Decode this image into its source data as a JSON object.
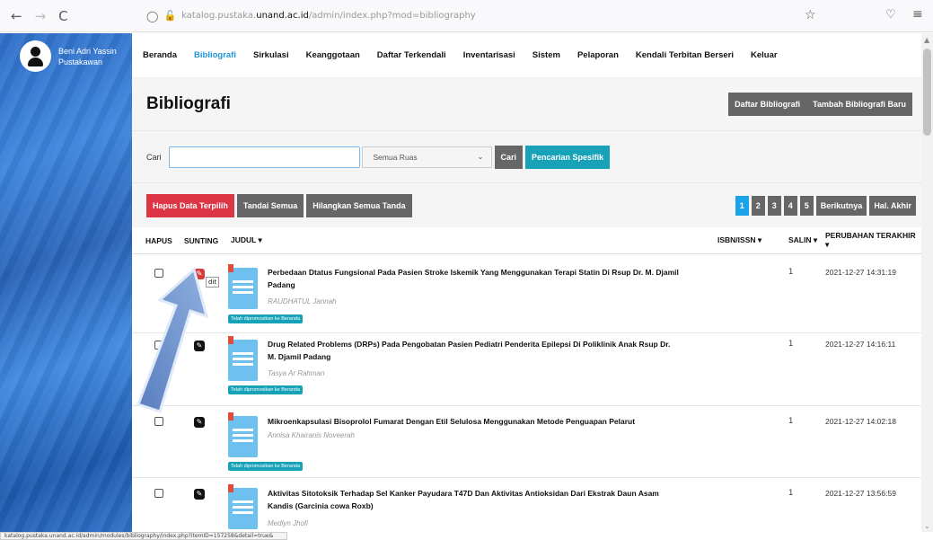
{
  "browser": {
    "back": "←",
    "forward": "→",
    "reload": "C",
    "url_prefix": "katalog.pustaka.",
    "url_host": "unand.ac.id",
    "url_path": "/admin/index.php?mod=bibliography",
    "status_url": "katalog.pustaka.unand.ac.id/admin/modules/bibliography/index.php?itemID=157258&detail=true&"
  },
  "sidebar": {
    "user_name": "Beni Adri Yassin",
    "user_role": "Pustakawan"
  },
  "nav": [
    "Beranda",
    "Bibliografi",
    "Sirkulasi",
    "Keanggotaan",
    "Daftar Terkendali",
    "Inventarisasi",
    "Sistem",
    "Pelaporan",
    "Kendali Terbitan Berseri",
    "Keluar"
  ],
  "page": {
    "title": "Bibliografi",
    "btn_list": "Daftar Bibliografi",
    "btn_add": "Tambah Bibliografi Baru"
  },
  "search": {
    "label": "Cari",
    "value": "",
    "field_select": "Semua Ruas",
    "btn_search": "Cari",
    "btn_advanced": "Pencarian Spesifik"
  },
  "actions": {
    "delete_selected": "Hapus Data Terpilih",
    "mark_all": "Tandai Semua",
    "unmark_all": "Hilangkan Semua Tanda"
  },
  "pagination": {
    "pages": [
      "1",
      "2",
      "3",
      "4",
      "5"
    ],
    "next": "Berikutnya",
    "last": "Hal. Akhir"
  },
  "table": {
    "headers": {
      "delete": "HAPUS",
      "edit": "SUNTING",
      "title": "JUDUL ▾",
      "isbn": "ISBN/ISSN ▾",
      "copies": "SALIN ▾",
      "modified": "PERUBAHAN TERAKHIR ▾"
    },
    "rows": [
      {
        "title": "Perbedaan Dtatus Fungsional Pada Pasien Stroke Iskemik Yang Menggunakan Terapi Statin Di Rsup Dr. M. Djamil Padang",
        "author": "RAUDHATUL Jannah",
        "badge": "Telah dipromosikan ke Beranda",
        "copies": "1",
        "modified": "2021-12-27 14:31:19"
      },
      {
        "title": "Drug Related Problems (DRPs) Pada Pengobatan Pasien Pediatri Penderita Epilepsi Di Poliklinik Anak Rsup Dr. M. Djamil Padang",
        "author": "Tasya Ar Rahman",
        "badge": "Telah dipromosikan ke Beranda",
        "copies": "1",
        "modified": "2021-12-27 14:16:11"
      },
      {
        "title": "Mikroenkapsulasi Bisoprolol Fumarat Dengan Etil Selulosa Menggunakan Metode Penguapan Pelarut",
        "author": "Annisa Khairanis Noveerah",
        "badge": "Telah dipromosikan ke Beranda",
        "copies": "1",
        "modified": "2021-12-27 14:02:18"
      },
      {
        "title": "Aktivitas Sitotoksik Terhadap Sel Kanker Payudara T47D Dan Aktivitas Antioksidan Dari Ekstrak Daun Asam Kandis (Garcinia cowa Roxb)",
        "author": "Medlyn Jhofi",
        "badge": "",
        "copies": "1",
        "modified": "2021-12-27 13:56:59"
      }
    ],
    "tooltip": "dit"
  },
  "icons": {
    "star": "☆",
    "pocket": "♡",
    "menu": "≡"
  }
}
